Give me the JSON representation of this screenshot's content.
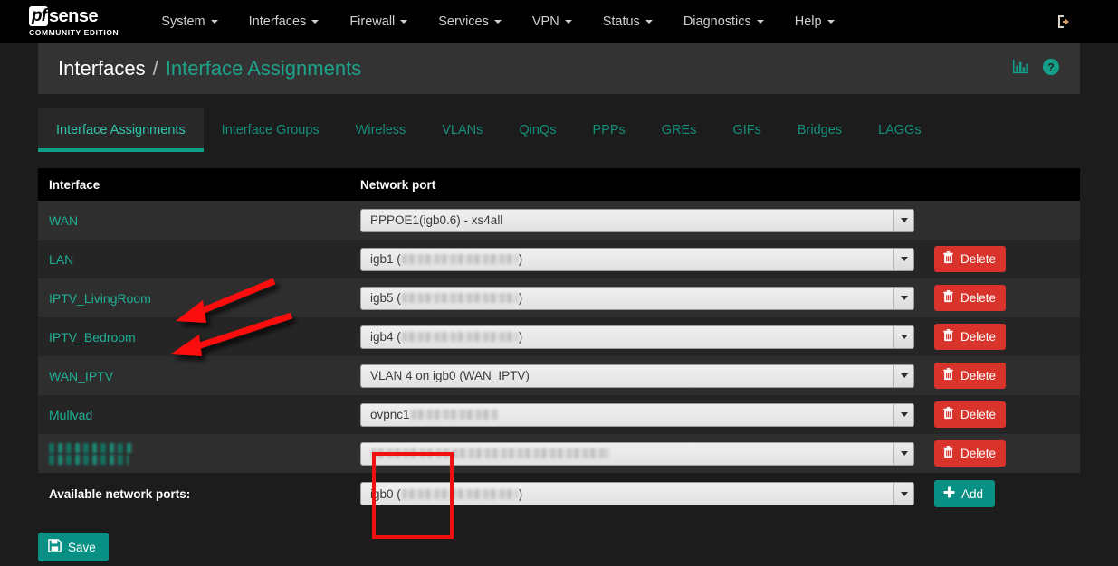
{
  "brand": {
    "badge": "pf",
    "word": "sense",
    "subtitle": "COMMUNITY EDITION"
  },
  "navbar": {
    "items": [
      {
        "label": "System"
      },
      {
        "label": "Interfaces"
      },
      {
        "label": "Firewall"
      },
      {
        "label": "Services"
      },
      {
        "label": "VPN"
      },
      {
        "label": "Status"
      },
      {
        "label": "Diagnostics"
      },
      {
        "label": "Help"
      }
    ],
    "logout_icon": "sign-out-icon"
  },
  "header": {
    "breadcrumb_root": "Interfaces",
    "breadcrumb_separator": "/",
    "breadcrumb_leaf": "Interface Assignments",
    "icons": [
      "stats-bar-chart-icon",
      "help-question-icon"
    ]
  },
  "tabs": [
    {
      "label": "Interface Assignments",
      "active": true
    },
    {
      "label": "Interface Groups",
      "active": false
    },
    {
      "label": "Wireless",
      "active": false
    },
    {
      "label": "VLANs",
      "active": false
    },
    {
      "label": "QinQs",
      "active": false
    },
    {
      "label": "PPPs",
      "active": false
    },
    {
      "label": "GREs",
      "active": false
    },
    {
      "label": "GIFs",
      "active": false
    },
    {
      "label": "Bridges",
      "active": false
    },
    {
      "label": "LAGGs",
      "active": false
    }
  ],
  "table": {
    "columns": {
      "interface": "Interface",
      "network_port": "Network port"
    },
    "rows": [
      {
        "interface": "WAN",
        "interface_redacted": false,
        "port_value": "PPPOE1(igb0.6) - xs4all",
        "port_redacted": false,
        "redacted_width": 0,
        "deletable": false,
        "delete_label": "Delete"
      },
      {
        "interface": "LAN",
        "interface_redacted": false,
        "port_value": "igb1 (",
        "port_suffix": ")",
        "port_redacted": true,
        "redacted_width": 128,
        "deletable": true,
        "delete_label": "Delete"
      },
      {
        "interface": "IPTV_LivingRoom",
        "interface_redacted": false,
        "port_value": "igb5 (",
        "port_suffix": ")",
        "port_redacted": true,
        "redacted_width": 128,
        "deletable": true,
        "delete_label": "Delete"
      },
      {
        "interface": "IPTV_Bedroom",
        "interface_redacted": false,
        "port_value": "igb4 (",
        "port_suffix": ")",
        "port_redacted": true,
        "redacted_width": 128,
        "deletable": true,
        "delete_label": "Delete"
      },
      {
        "interface": "WAN_IPTV",
        "interface_redacted": false,
        "port_value": "VLAN 4 on igb0 (WAN_IPTV)",
        "port_redacted": false,
        "redacted_width": 0,
        "deletable": true,
        "delete_label": "Delete"
      },
      {
        "interface": "Mullvad",
        "interface_redacted": false,
        "port_value": "ovpnc1 ",
        "port_suffix": "",
        "port_redacted": true,
        "redacted_width": 96,
        "deletable": true,
        "delete_label": "Delete"
      },
      {
        "interface": "",
        "interface_redacted": true,
        "port_value": "",
        "port_suffix": "",
        "port_redacted": true,
        "redacted_width": 262,
        "deletable": true,
        "delete_label": "Delete"
      }
    ]
  },
  "available_ports": {
    "label": "Available network ports:",
    "value": "igb0 (",
    "suffix": ")",
    "redacted": true,
    "redacted_width": 128,
    "add_label": "Add"
  },
  "footer": {
    "save_label": "Save"
  },
  "annotations": {
    "highlight_rect": {
      "color": "#f10f0f"
    },
    "arrows": [
      {
        "target": "IPTV_LivingRoom",
        "color": "#fb0d0d"
      },
      {
        "target": "IPTV_Bedroom",
        "color": "#fb0d0d"
      }
    ]
  },
  "colors": {
    "accent_teal": "#10a08a",
    "link_teal": "#1faf95",
    "danger_red": "#d9342b",
    "navbar_black": "#000000",
    "page_bg": "#1c1c1c",
    "annotation_red": "#f10f0f"
  }
}
